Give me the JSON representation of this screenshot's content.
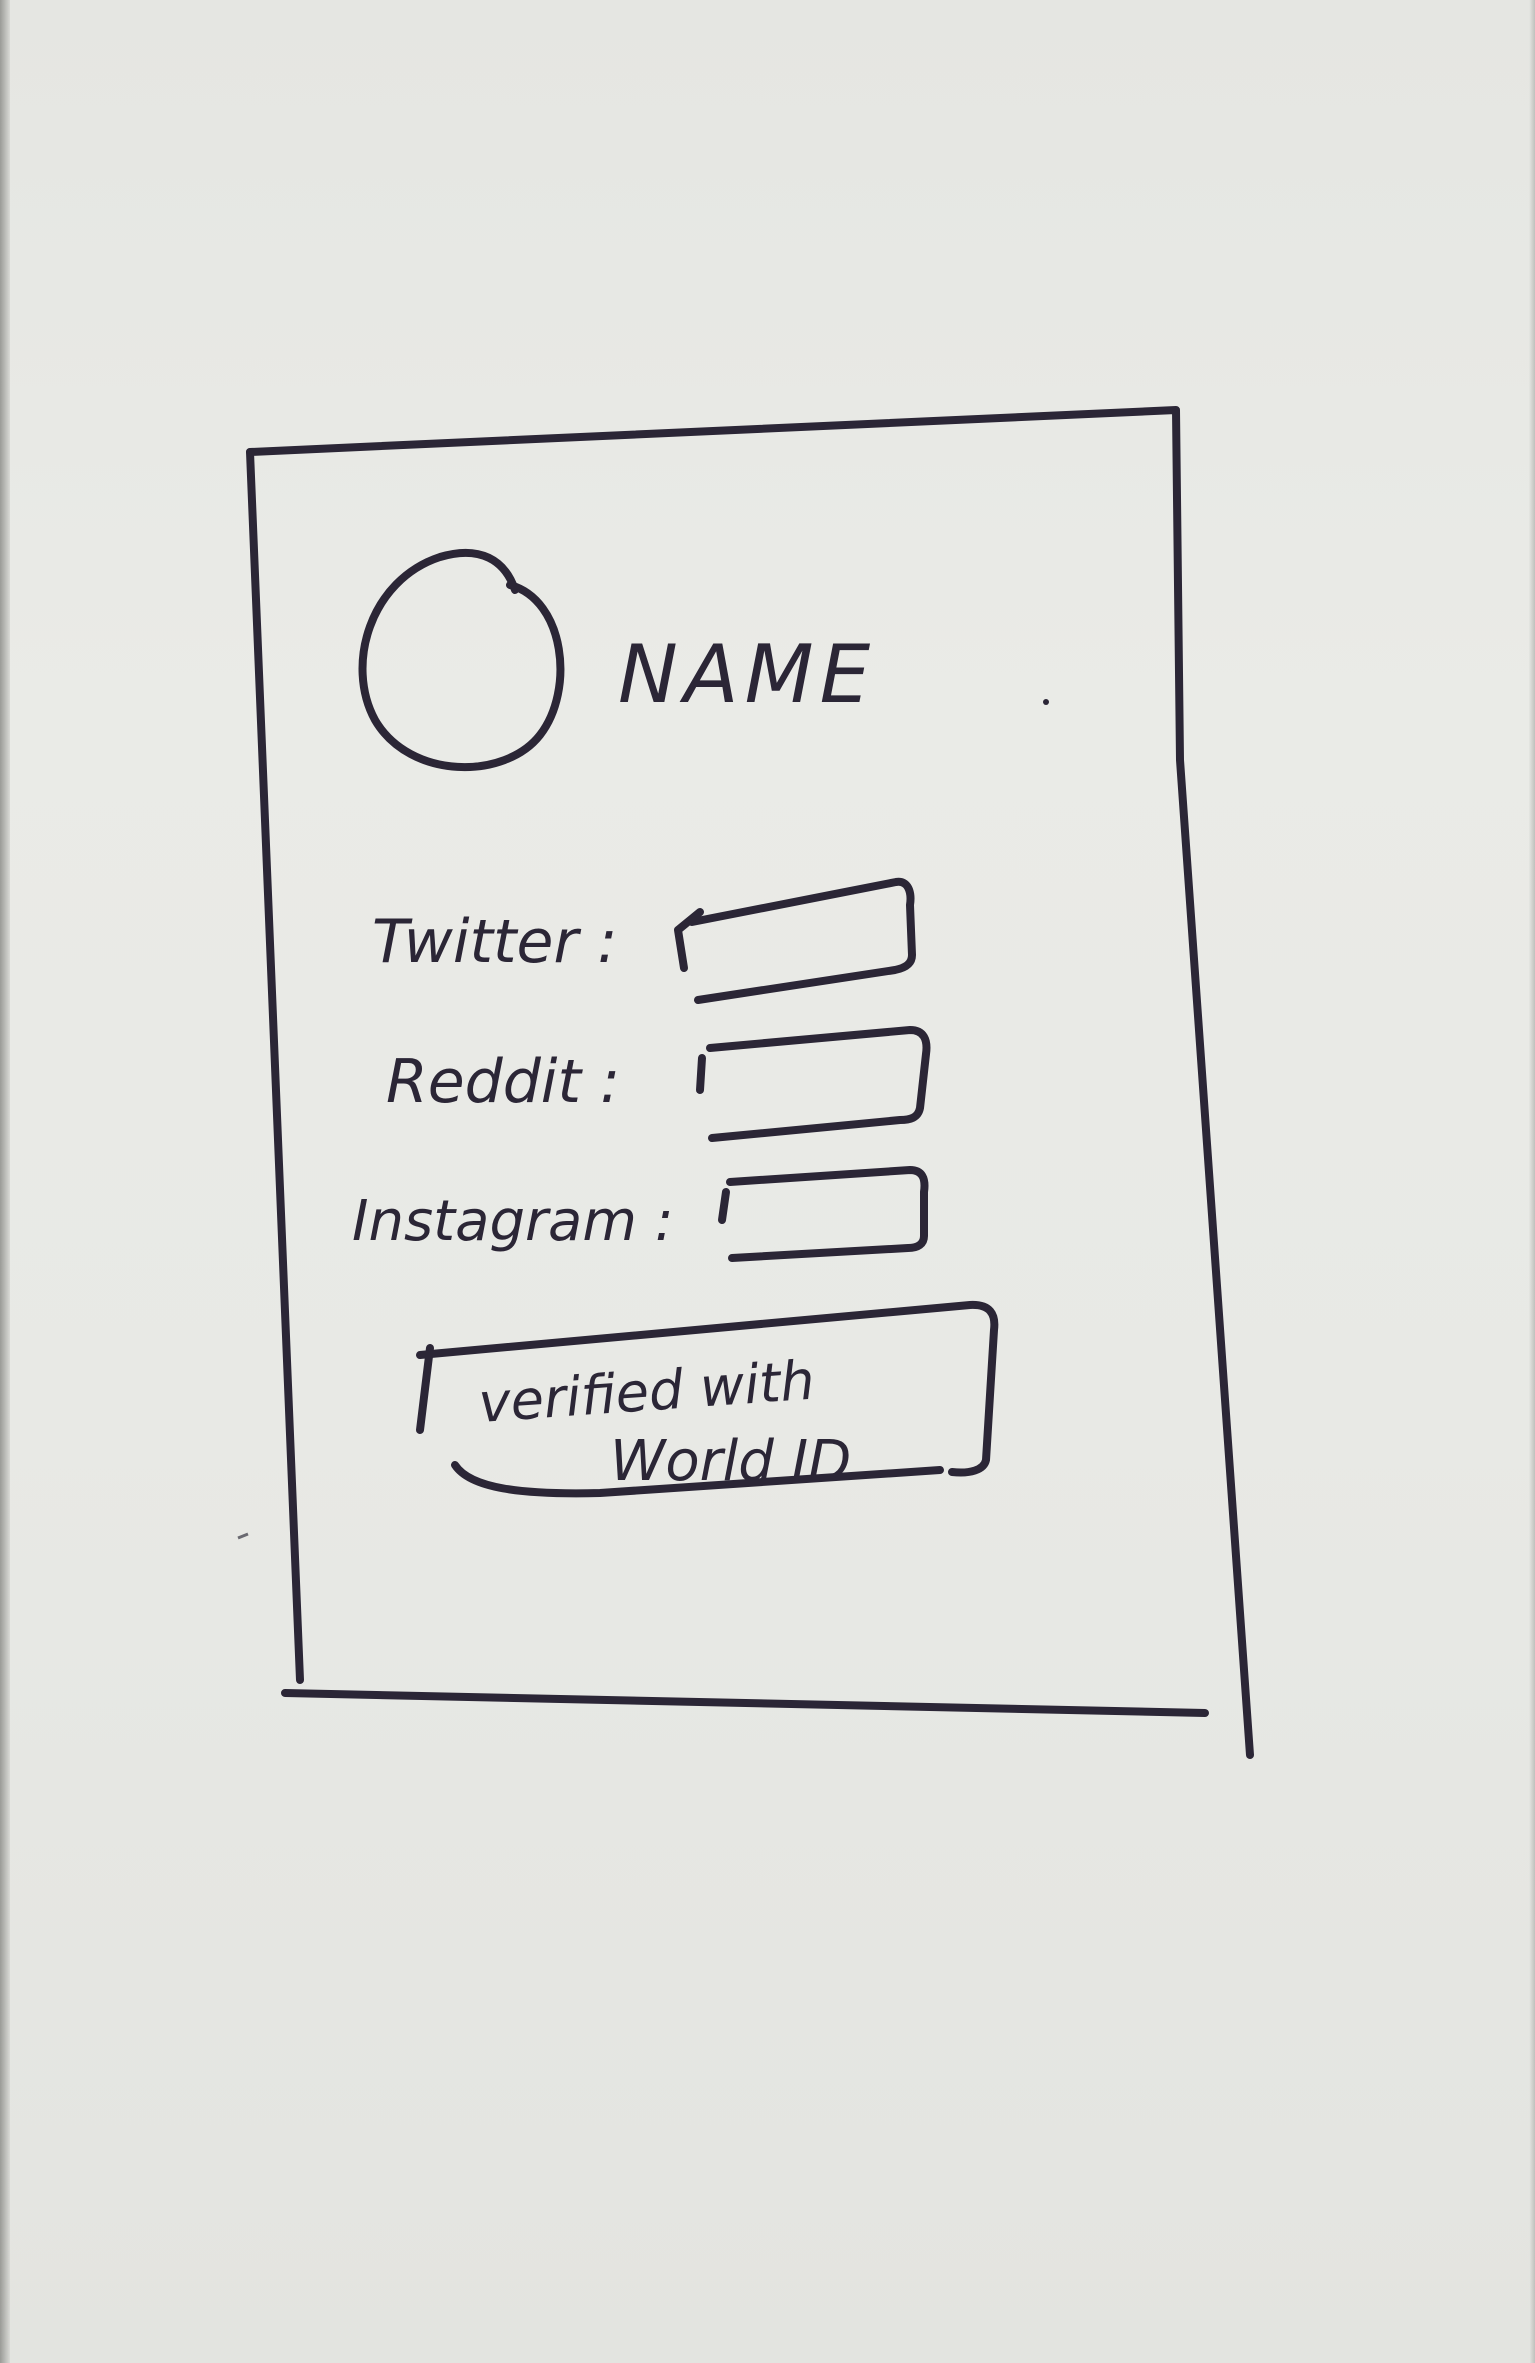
{
  "profile": {
    "name": "NAME"
  },
  "fields": [
    {
      "label": "Twitter :",
      "value": ""
    },
    {
      "label": "Reddit :",
      "value": ""
    },
    {
      "label": "Instagram :",
      "value": ""
    }
  ],
  "verify_button": {
    "line1": "verified with",
    "line2": "World ID"
  },
  "colors": {
    "ink": "#2b2636",
    "paper": "#e8e9e5"
  }
}
